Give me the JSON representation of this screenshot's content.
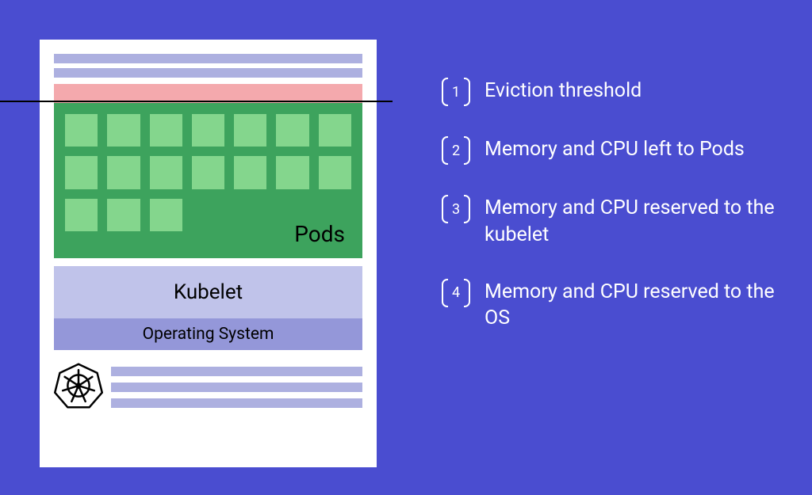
{
  "card": {
    "pods_label": "Pods",
    "kubelet_label": "Kubelet",
    "os_label": "Operating System",
    "pod_count": 17
  },
  "legend": {
    "items": [
      {
        "num": "1",
        "text": "Eviction threshold"
      },
      {
        "num": "2",
        "text": "Memory and CPU left to Pods"
      },
      {
        "num": "3",
        "text": "Memory and CPU reserved to the kubelet"
      },
      {
        "num": "4",
        "text": "Memory and CPU reserved to the OS"
      }
    ]
  },
  "colors": {
    "bg": "#4a4dd0",
    "card": "#ffffff",
    "bars": "#adb0e0",
    "pink": "#f4a9ad",
    "pods_bg": "#3da35d",
    "pod": "#84d68d",
    "kubelet": "#c0c3ea",
    "os": "#9497d9"
  }
}
